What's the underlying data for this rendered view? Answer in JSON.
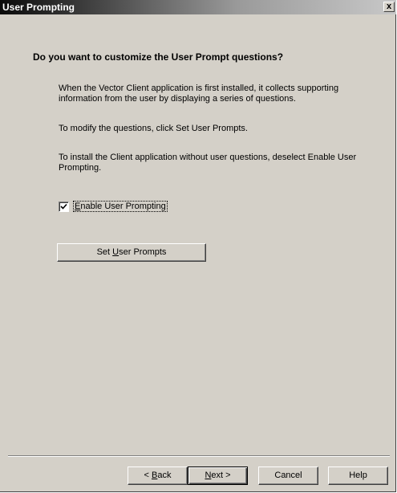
{
  "window": {
    "title": "User Prompting",
    "close_glyph": "x"
  },
  "content": {
    "heading": "Do you want to customize the User Prompt questions?",
    "para1": "When the Vector Client application is first installed, it collects supporting information from the user by displaying a series of questions.",
    "para2": "To modify the questions, click Set User Prompts.",
    "para3": "To install the Client application without user questions, deselect Enable User Prompting."
  },
  "checkbox": {
    "label_pre": "",
    "label_mnemonic": "E",
    "label_post": "nable User Prompting",
    "checked": true
  },
  "set_prompts_button": {
    "label_pre": "Set ",
    "label_mnemonic": "U",
    "label_post": "ser Prompts"
  },
  "footer": {
    "back": {
      "prefix": "< ",
      "mnemonic": "B",
      "rest": "ack"
    },
    "next": {
      "mnemonic": "N",
      "rest": "ext",
      "suffix": " >"
    },
    "cancel": "Cancel",
    "help": "Help"
  },
  "icons": {
    "checkmark": "check-icon",
    "close": "close-icon"
  }
}
